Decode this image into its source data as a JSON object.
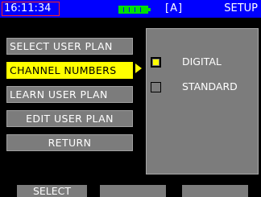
{
  "status_bar": {
    "time": "16:11:34",
    "mode": "[A]",
    "screen_title": "SETUP",
    "battery_icon": "battery-full-icon"
  },
  "menu": {
    "items": [
      {
        "label": "SELECT USER PLAN",
        "active": false
      },
      {
        "label": "CHANNEL NUMBERS",
        "active": true
      },
      {
        "label": "LEARN USER PLAN",
        "active": false
      },
      {
        "label": "EDIT USER PLAN",
        "active": false
      },
      {
        "label": "RETURN",
        "active": false
      }
    ]
  },
  "options": {
    "items": [
      {
        "label": "DIGITAL",
        "checked": true
      },
      {
        "label": "STANDARD",
        "checked": false
      }
    ]
  },
  "softkeys": {
    "key1": "SELECT",
    "key2": "",
    "key3": ""
  },
  "colors": {
    "status_bar": "#0000ff",
    "highlight": "#ffff00",
    "button": "#7c7c7c",
    "battery": "#00e000"
  }
}
